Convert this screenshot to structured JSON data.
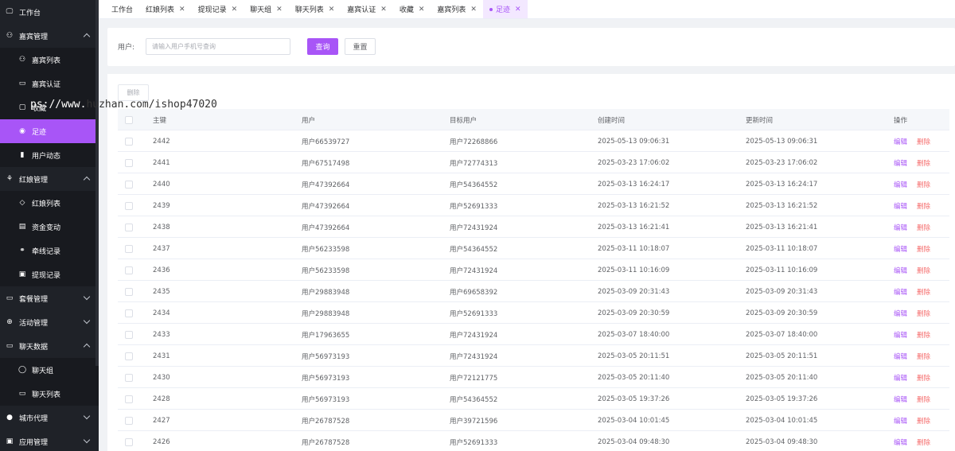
{
  "sidebar": {
    "items": [
      {
        "label": "工作台",
        "icon": "monitor-icon",
        "glyph": "🖵",
        "type": "top"
      },
      {
        "label": "嘉宾管理",
        "icon": "user-icon",
        "glyph": "⚇",
        "type": "group",
        "expanded": true
      },
      {
        "label": "嘉宾列表",
        "icon": "user-icon",
        "glyph": "⚇",
        "type": "sub"
      },
      {
        "label": "嘉宾认证",
        "icon": "certificate-icon",
        "glyph": "▭",
        "type": "sub"
      },
      {
        "label": "收藏",
        "icon": "collection-icon",
        "glyph": "▢",
        "type": "sub"
      },
      {
        "label": "足迹",
        "icon": "location-icon",
        "glyph": "◉",
        "type": "sub",
        "active": true
      },
      {
        "label": "用户动态",
        "icon": "chart-icon",
        "glyph": "▮",
        "type": "sub"
      },
      {
        "label": "红娘管理",
        "icon": "team-icon",
        "glyph": "⚘",
        "type": "group",
        "expanded": true
      },
      {
        "label": "红娘列表",
        "icon": "gem-icon",
        "glyph": "◇",
        "type": "sub"
      },
      {
        "label": "资金变动",
        "icon": "ledger-icon",
        "glyph": "▤",
        "type": "sub"
      },
      {
        "label": "牵线记录",
        "icon": "link-icon",
        "glyph": "⚭",
        "type": "sub"
      },
      {
        "label": "提现记录",
        "icon": "wallet-icon",
        "glyph": "▣",
        "type": "sub"
      },
      {
        "label": "套餐管理",
        "icon": "package-icon",
        "glyph": "▭",
        "type": "group",
        "expanded": false
      },
      {
        "label": "活动管理",
        "icon": "globe-icon",
        "glyph": "⊕",
        "type": "group",
        "expanded": false
      },
      {
        "label": "聊天数据",
        "icon": "message-icon",
        "glyph": "▭",
        "type": "group",
        "expanded": true
      },
      {
        "label": "聊天组",
        "icon": "chat-bubble-icon",
        "glyph": "◯",
        "type": "sub"
      },
      {
        "label": "聊天列表",
        "icon": "chat-list-icon",
        "glyph": "▭",
        "type": "sub"
      },
      {
        "label": "城市代理",
        "icon": "city-icon",
        "glyph": "●",
        "type": "group",
        "expanded": false
      },
      {
        "label": "应用管理",
        "icon": "app-icon",
        "glyph": "▣",
        "type": "group",
        "expanded": false
      }
    ]
  },
  "watermark": {
    "part1": "ps://www.",
    "part2": "huzhan",
    "part3": ".com/ishop47020"
  },
  "tabs": [
    {
      "label": "工作台",
      "closable": false
    },
    {
      "label": "红娘列表",
      "closable": true
    },
    {
      "label": "提现记录",
      "closable": true
    },
    {
      "label": "聊天组",
      "closable": true
    },
    {
      "label": "聊天列表",
      "closable": true
    },
    {
      "label": "嘉宾认证",
      "closable": true
    },
    {
      "label": "收藏",
      "closable": true
    },
    {
      "label": "嘉宾列表",
      "closable": true
    },
    {
      "label": "足迹",
      "closable": true,
      "active": true
    }
  ],
  "search": {
    "label": "用户:",
    "placeholder": "请输入用户手机号查询",
    "query_label": "查询",
    "reset_label": "重置"
  },
  "table": {
    "delete_label": "删除",
    "headers": {
      "id": "主键",
      "user": "用户",
      "target": "目标用户",
      "created": "创建时间",
      "updated": "更新时间",
      "ops": "操作"
    },
    "edit_label": "编辑",
    "row_delete_label": "删除",
    "rows": [
      {
        "id": "2442",
        "user": "用户66539727",
        "target": "用户72268866",
        "created": "2025-05-13 09:06:31",
        "updated": "2025-05-13 09:06:31"
      },
      {
        "id": "2441",
        "user": "用户67517498",
        "target": "用户72774313",
        "created": "2025-03-23 17:06:02",
        "updated": "2025-03-23 17:06:02"
      },
      {
        "id": "2440",
        "user": "用户47392664",
        "target": "用户54364552",
        "created": "2025-03-13 16:24:17",
        "updated": "2025-03-13 16:24:17"
      },
      {
        "id": "2439",
        "user": "用户47392664",
        "target": "用户52691333",
        "created": "2025-03-13 16:21:52",
        "updated": "2025-03-13 16:21:52"
      },
      {
        "id": "2438",
        "user": "用户47392664",
        "target": "用户72431924",
        "created": "2025-03-13 16:21:41",
        "updated": "2025-03-13 16:21:41"
      },
      {
        "id": "2437",
        "user": "用户56233598",
        "target": "用户54364552",
        "created": "2025-03-11 10:18:07",
        "updated": "2025-03-11 10:18:07"
      },
      {
        "id": "2436",
        "user": "用户56233598",
        "target": "用户72431924",
        "created": "2025-03-11 10:16:09",
        "updated": "2025-03-11 10:16:09"
      },
      {
        "id": "2435",
        "user": "用户29883948",
        "target": "用户69658392",
        "created": "2025-03-09 20:31:43",
        "updated": "2025-03-09 20:31:43"
      },
      {
        "id": "2434",
        "user": "用户29883948",
        "target": "用户52691333",
        "created": "2025-03-09 20:30:59",
        "updated": "2025-03-09 20:30:59"
      },
      {
        "id": "2433",
        "user": "用户17963655",
        "target": "用户72431924",
        "created": "2025-03-07 18:40:00",
        "updated": "2025-03-07 18:40:00"
      },
      {
        "id": "2431",
        "user": "用户56973193",
        "target": "用户72431924",
        "created": "2025-03-05 20:11:51",
        "updated": "2025-03-05 20:11:51"
      },
      {
        "id": "2430",
        "user": "用户56973193",
        "target": "用户72121775",
        "created": "2025-03-05 20:11:40",
        "updated": "2025-03-05 20:11:40"
      },
      {
        "id": "2428",
        "user": "用户56973193",
        "target": "用户54364552",
        "created": "2025-03-05 19:37:26",
        "updated": "2025-03-05 19:37:26"
      },
      {
        "id": "2427",
        "user": "用户26787528",
        "target": "用户39721596",
        "created": "2025-03-04 10:01:45",
        "updated": "2025-03-04 10:01:45"
      },
      {
        "id": "2426",
        "user": "用户26787528",
        "target": "用户52691333",
        "created": "2025-03-04 09:48:30",
        "updated": "2025-03-04 09:48:30"
      }
    ]
  },
  "colors": {
    "accent": "#a855f7",
    "sidebar_bg": "#1f2228",
    "danger": "#f56c6c"
  }
}
